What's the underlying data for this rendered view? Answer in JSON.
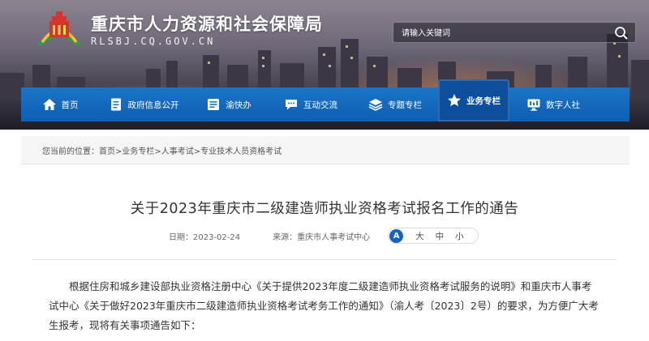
{
  "header": {
    "site_title": "重庆市人力资源和社会保障局",
    "site_url": "RLSBJ.CQ.GOV.CN",
    "search_placeholder": "请输入关键词"
  },
  "nav": {
    "items": [
      {
        "label": "首页",
        "icon": "home-icon"
      },
      {
        "label": "政府信息公开",
        "icon": "document-icon"
      },
      {
        "label": "渝快办",
        "icon": "id-card-icon"
      },
      {
        "label": "互动交流",
        "icon": "chat-icon"
      },
      {
        "label": "专题专栏",
        "icon": "layers-icon"
      },
      {
        "label": "业务专栏",
        "icon": "star-icon",
        "active": true
      },
      {
        "label": "数字人社",
        "icon": "monitor-icon"
      }
    ]
  },
  "breadcrumb": {
    "prefix": "您当前的位置：",
    "items": [
      "首页",
      "业务专栏",
      "人事考试",
      "专业技术人员资格考试"
    ],
    "separator": ">"
  },
  "article": {
    "title": "关于2023年重庆市二级建造师执业资格考试报名工作的通告",
    "date_label": "日期：2023-02-24",
    "source_label": "来源：重庆市人事考试中心",
    "font_sizes": [
      "大",
      "中",
      "小"
    ],
    "body": "根据住房和城乡建设部执业资格注册中心《关于提供2023年度二级建造师执业资格考试服务的说明》和重庆市人事考试中心《关于做好2023年重庆市二级建造师执业资格考试考务工作的通知》（渝人考〔2023〕2号）的要求，为方便广大考生报考，现将有关事项通告如下："
  },
  "colors": {
    "nav_blue": "#1b74c8",
    "nav_active": "#0d4f9c",
    "accent": "#1565c0"
  }
}
